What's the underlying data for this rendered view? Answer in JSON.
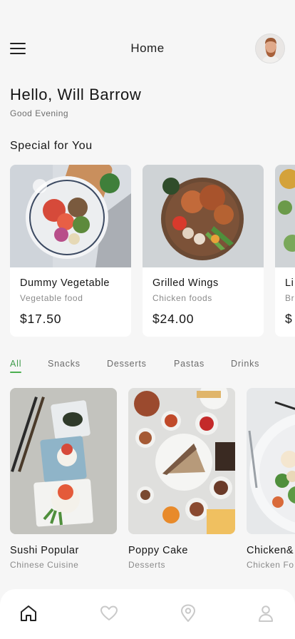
{
  "header": {
    "title": "Home",
    "menu_icon": "hamburger-menu-icon",
    "avatar": "user-avatar"
  },
  "greeting": {
    "title": "Hello, Will Barrow",
    "subtitle": "Good Evening"
  },
  "specials": {
    "title": "Special for You",
    "items": [
      {
        "name": "Dummy Vegetable",
        "category": "Vegetable food",
        "price": "$17.50"
      },
      {
        "name": "Grilled Wings",
        "category": "Chicken foods",
        "price": "$24.00"
      },
      {
        "name": "Li",
        "category": "Br",
        "price": "$"
      }
    ]
  },
  "categories": {
    "active": "All",
    "items": [
      "All",
      "Snacks",
      "Desserts",
      "Pastas",
      "Drinks"
    ]
  },
  "dishes": [
    {
      "name": "Sushi Popular",
      "category": "Chinese Cuisine"
    },
    {
      "name": "Poppy Cake",
      "category": "Desserts"
    },
    {
      "name": "Chicken&",
      "category": "Chicken Fo"
    }
  ],
  "bottom_nav": {
    "items": [
      "home-icon",
      "heart-icon",
      "location-pin-icon",
      "profile-icon"
    ],
    "active": "home-icon"
  },
  "colors": {
    "accent": "#4caf50",
    "background": "#f6f6f6",
    "card": "#ffffff"
  }
}
